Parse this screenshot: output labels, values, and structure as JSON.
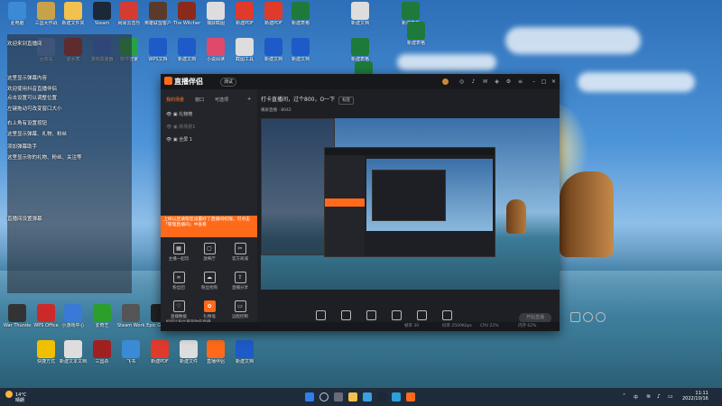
{
  "desktop": {
    "icons_row1": [
      {
        "label": "此电脑",
        "color": "#3a8ad6"
      },
      {
        "label": "三国大作战",
        "color": "#c8a24a"
      },
      {
        "label": "新建文件夹",
        "color": "#f2c14e"
      },
      {
        "label": "Steam",
        "color": "#1b2838"
      },
      {
        "label": "网易云音乐",
        "color": "#d43c33"
      },
      {
        "label": "英雄联盟客户端",
        "color": "#5a3a2a"
      },
      {
        "label": "The Witcher 3",
        "color": "#8a2a1a"
      },
      {
        "label": "捕获截图",
        "color": "#dddddd"
      },
      {
        "label": "新建PDF",
        "color": "#e03a2a"
      },
      {
        "label": "新建PDF",
        "color": "#e03a2a"
      },
      {
        "label": "新建表格",
        "color": "#1e7a3a"
      },
      {
        "label": "新建文档",
        "color": "#dddddd"
      },
      {
        "label": "新建表格",
        "color": "#1e7a3a"
      },
      {
        "label": "新建表格",
        "color": "#1e7a3a"
      }
    ],
    "icons_row2": [
      {
        "label": "回收站",
        "color": "#5a8ad6"
      },
      {
        "label": "逆水寒",
        "color": "#a03030"
      },
      {
        "label": "游戏加速器",
        "color": "#3a6ad6"
      },
      {
        "label": "WPS文档",
        "color": "#1e5ac8"
      },
      {
        "label": "软件管家",
        "color": "#28a048"
      },
      {
        "label": "新建文档",
        "color": "#1e5ac8"
      },
      {
        "label": "小说阅读",
        "color": "#e04a6a"
      },
      {
        "label": "截图工具",
        "color": "#dddddd"
      },
      {
        "label": "新建文档",
        "color": "#1e5ac8"
      },
      {
        "label": "新建文档",
        "color": "#1e5ac8"
      },
      {
        "label": "新建表格",
        "color": "#1e7a3a"
      },
      {
        "label": "新建表格",
        "color": "#1e7a3a"
      }
    ],
    "icons_col_bottom": [
      {
        "label": "War Thunder",
        "color": "#333333"
      },
      {
        "label": "WPS Office",
        "color": "#cc2a2a"
      },
      {
        "label": "小游戏中心",
        "color": "#3a7ad6"
      },
      {
        "label": "爱奇艺",
        "color": "#2aa02a"
      },
      {
        "label": "Steam Works",
        "color": "#555555"
      },
      {
        "label": "Epic Games",
        "color": "#222222"
      },
      {
        "label": "快捷方式",
        "color": "#f0c000"
      },
      {
        "label": "新建文本文档",
        "color": "#dddddd"
      },
      {
        "label": "三国杀",
        "color": "#a02020"
      },
      {
        "label": "飞书",
        "color": "#3a8ad6"
      },
      {
        "label": "新建PDF",
        "color": "#e03a2a"
      },
      {
        "label": "新建文件",
        "color": "#dddddd"
      },
      {
        "label": "直播伴侣",
        "color": "#ff6a1a"
      },
      {
        "label": "新建文档",
        "color": "#1e5ac8"
      }
    ]
  },
  "chat_overlay": {
    "lines": [
      "欢迎来到直播间",
      "这里显示弹幕内容",
      "欢迎使用抖音直播伴侣",
      "点击设置可以调整位置",
      "左键拖动可改变窗口大小",
      "右上角有设置按钮",
      "这里显示弹幕、礼物、粉丝",
      "添加弹幕助手",
      "这里显示你的礼物、粉丝、关注等",
      "直播间设置弹幕"
    ]
  },
  "app": {
    "brand": "直播伴侣",
    "version_pill": "测试",
    "tabs": [
      "我的场景",
      "窗口",
      "可选项"
    ],
    "scenes": [
      "礼物榜",
      "新场景1",
      "全屏 1"
    ],
    "banner_text": "上线以后请帮您设置好了直播间权限，可点击「管理直播间」中查看",
    "tools": [
      {
        "label": "主播一起玩",
        "icon": "gamepad-icon"
      },
      {
        "label": "放映厅",
        "icon": "box-icon"
      },
      {
        "label": "官方商城",
        "icon": "scissors-icon"
      },
      {
        "label": "粉丝团",
        "icon": "link-icon"
      },
      {
        "label": "粉丝抢购",
        "icon": "cloud-icon"
      },
      {
        "label": "直播分享",
        "icon": "upload-icon"
      },
      {
        "label": "直播数据",
        "icon": "heart-icon"
      },
      {
        "label": "礼物墙",
        "icon": "gift-icon"
      },
      {
        "label": "远程控制",
        "icon": "monitor-icon"
      }
    ],
    "bottom_tip": "如何让粉丝看到你的直播",
    "info_title": "打卡直播间，过个800，O一下",
    "info_badge": "标签",
    "subbar_text": "横屏直播",
    "subbar_count": "8042",
    "controls": [
      "直播屏幕",
      "摄像头",
      "手机投屏",
      "多媒体",
      "麦克风",
      "扬声器"
    ],
    "golive_label": "开始直播",
    "footer_items": [
      "帧率 30",
      "码率 2500Kbps",
      "CPU 21%",
      "内存 62%"
    ]
  },
  "taskbar": {
    "weather_temp": "14°C",
    "weather_desc": "晴朗",
    "time": "11:11",
    "date": "2022/10/16",
    "lang": "中"
  }
}
